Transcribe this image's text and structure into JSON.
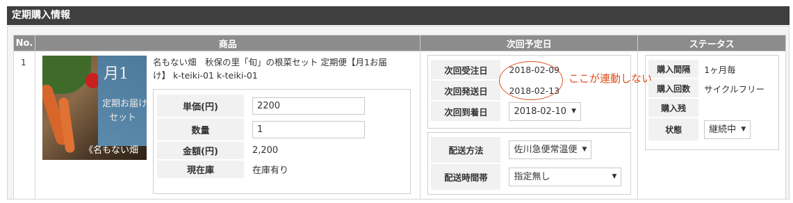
{
  "section": {
    "title": "定期購入情報"
  },
  "table": {
    "headers": {
      "no": "No.",
      "product": "商品",
      "next": "次回予定日",
      "status": "ステータス"
    }
  },
  "row": {
    "no": "1",
    "product": {
      "image_text": {
        "line1": "月1",
        "line2": "定期お届け",
        "line3": "セット",
        "line4": "《名もない畑"
      },
      "name": "名もない畑　秋保の里「旬」の根菜セット 定期便【月1お届け】 k-teiki-01 k-teiki-01",
      "unit_price_label": "単価(円)",
      "unit_price_value": "2200",
      "quantity_label": "数量",
      "quantity_value": "1",
      "amount_label": "金額(円)",
      "amount_value": "2,200",
      "stock_label": "現在庫",
      "stock_value": "在庫有り"
    },
    "next": {
      "order_date_label": "次回受注日",
      "order_date_value": "2018-02-09",
      "ship_date_label": "次回発送日",
      "ship_date_value": "2018-02-13",
      "arrival_date_label": "次回到着日",
      "arrival_date_value": "2018-02-10",
      "delivery_method_label": "配送方法",
      "delivery_method_value": "佐川急便常温便",
      "delivery_time_label": "配送時間帯",
      "delivery_time_value": "指定無し",
      "annotation": "ここが連動しない"
    },
    "status": {
      "interval_label": "購入間隔",
      "interval_value": "1ヶ月毎",
      "count_label": "購入回数",
      "count_value": "サイクルフリー",
      "remaining_label": "購入残",
      "remaining_value": "",
      "state_label": "状態",
      "state_value": "継続中"
    }
  },
  "colors": {
    "header_bg": "#3f3f3f",
    "column_header_bg": "#8c8c8c",
    "annotation": "#e0501c"
  }
}
